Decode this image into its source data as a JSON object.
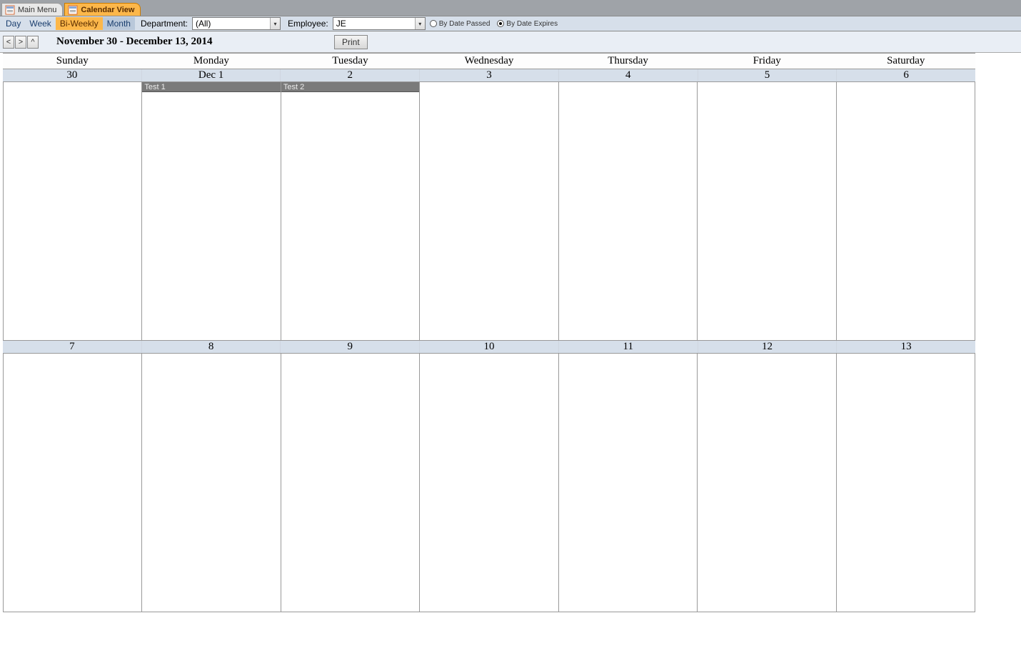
{
  "tabs": {
    "main_menu": "Main Menu",
    "calendar_view": "Calendar View"
  },
  "toolbar": {
    "views": {
      "day": "Day",
      "week": "Week",
      "biweekly": "Bi-Weekly",
      "month": "Month"
    },
    "department_label": "Department:",
    "department_value": "(All)",
    "employee_label": "Employee:",
    "employee_value": "JE",
    "radio_passed": "By Date Passed",
    "radio_expires": "By Date Expires"
  },
  "subtoolbar": {
    "prev": "<",
    "next": ">",
    "up": "^",
    "range": "November 30 - December 13, 2014",
    "print": "Print"
  },
  "days": [
    "Sunday",
    "Monday",
    "Tuesday",
    "Wednesday",
    "Thursday",
    "Friday",
    "Saturday"
  ],
  "week1_dates": [
    "30",
    "Dec 1",
    "2",
    "3",
    "4",
    "5",
    "6"
  ],
  "week2_dates": [
    "7",
    "8",
    "9",
    "10",
    "11",
    "12",
    "13"
  ],
  "events": {
    "w1d1": "Test 1",
    "w1d2": "Test 2"
  }
}
